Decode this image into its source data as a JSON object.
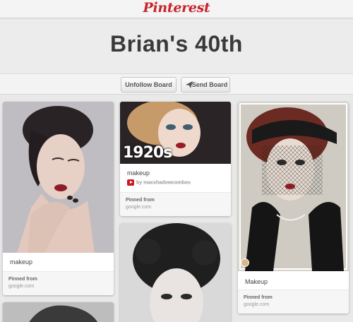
{
  "header": {
    "logo": "Pinterest"
  },
  "board": {
    "title": "Brian's 40th"
  },
  "actions": {
    "unfollow_label": "Unfollow Board",
    "send_label": "Send Board"
  },
  "pins": [
    {
      "description": "makeup",
      "pinned_label": "Pinned from",
      "source": "google.com"
    },
    {
      "overlay_text": "1920s",
      "description": "makeup",
      "via": "by macshadowcombos",
      "pinned_label": "Pinned from",
      "source": "google.com"
    },
    {
      "description": "Makeup",
      "pinned_label": "Pinned from",
      "source": "google.com"
    }
  ],
  "colors": {
    "brand": "#c8232c",
    "background": "#e9e9e9"
  }
}
